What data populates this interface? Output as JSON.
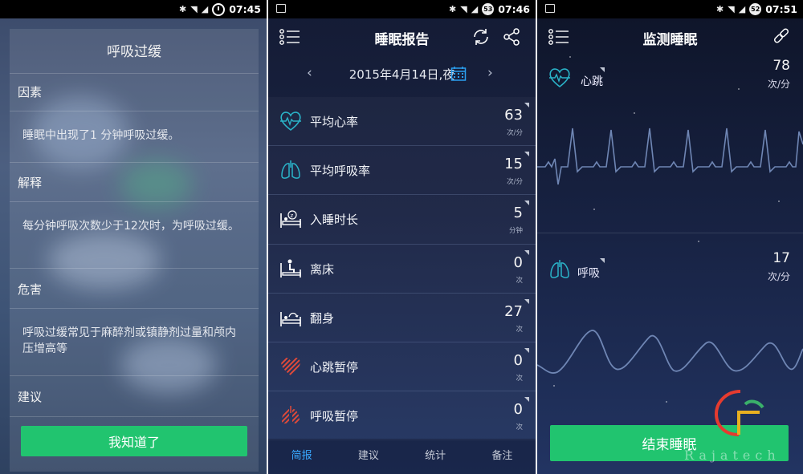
{
  "status_times": [
    "07:45",
    "07:46",
    "07:51"
  ],
  "status_badges": [
    "",
    "53",
    "52"
  ],
  "screen1": {
    "title": "呼吸过缓",
    "sections": [
      {
        "heading": "因素",
        "body": "睡眠中出现了1 分钟呼吸过缓。"
      },
      {
        "heading": "解释",
        "body": "每分钟呼吸次数少于12次时，为呼吸过缓。"
      },
      {
        "heading": "危害",
        "body": "呼吸过缓常见于麻醉剂或镇静剂过量和颅内压增高等"
      },
      {
        "heading": "建议",
        "body": ""
      }
    ],
    "button_label": "我知道了"
  },
  "screen2": {
    "title": "睡眠报告",
    "date": "2015年4月14日,夜",
    "rows": [
      {
        "label": "平均心率",
        "value": "63",
        "unit": "次/分",
        "icon": "heart-rate-icon"
      },
      {
        "label": "平均呼吸率",
        "value": "15",
        "unit": "次/分",
        "icon": "lungs-icon"
      },
      {
        "label": "入睡时长",
        "value": "5",
        "unit": "分钟",
        "icon": "sleep-bed-icon"
      },
      {
        "label": "离床",
        "value": "0",
        "unit": "次",
        "icon": "leave-bed-icon"
      },
      {
        "label": "翻身",
        "value": "27",
        "unit": "次",
        "icon": "turn-over-icon"
      },
      {
        "label": "心跳暂停",
        "value": "0",
        "unit": "次",
        "icon": "heart-pause-icon"
      },
      {
        "label": "呼吸暂停",
        "value": "0",
        "unit": "次",
        "icon": "breath-pause-icon"
      }
    ],
    "tabs": [
      "简报",
      "建议",
      "统计",
      "备注"
    ],
    "active_tab": 0
  },
  "screen3": {
    "title": "监测睡眠",
    "heart": {
      "label": "心跳",
      "value": "78",
      "unit": "次/分"
    },
    "breath": {
      "label": "呼吸",
      "value": "17",
      "unit": "次/分"
    },
    "button_label": "结束睡眠"
  },
  "watermark": "Rajatech",
  "colors": {
    "accent_green": "#21c46f",
    "tab_active": "#39a9ff",
    "icon_teal": "#2ab3c8",
    "icon_red": "#e04a3a"
  }
}
